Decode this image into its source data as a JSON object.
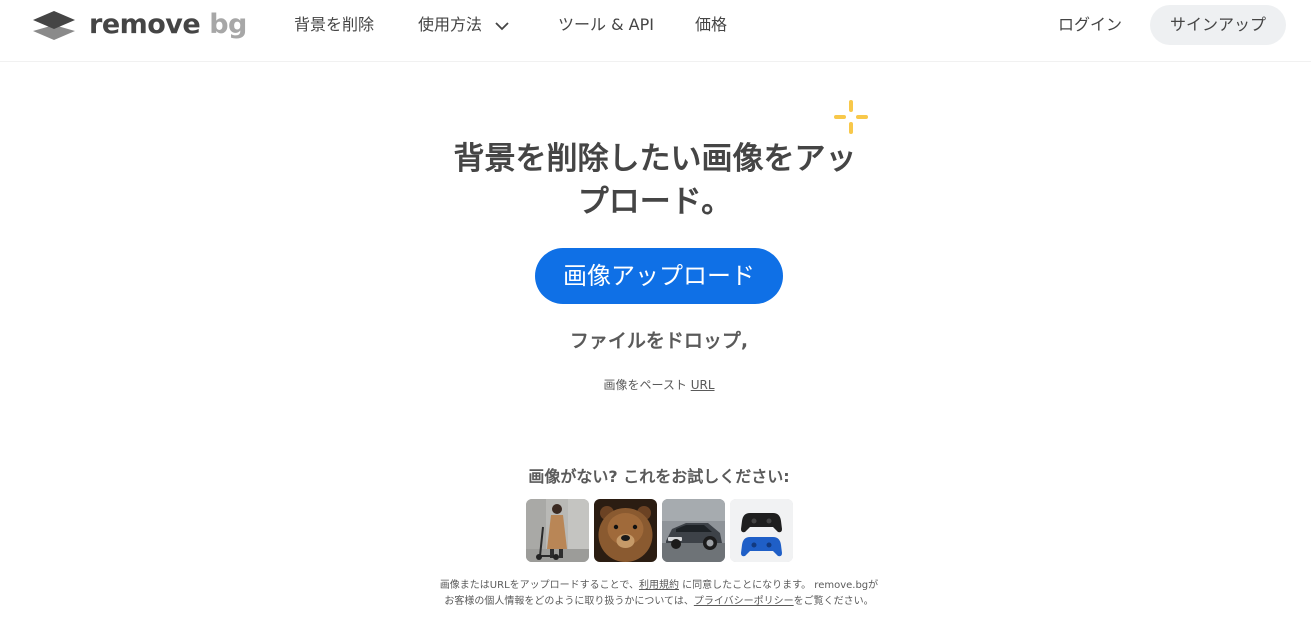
{
  "header": {
    "logo": {
      "word1": "remove",
      "word2": "bg"
    },
    "nav": [
      {
        "label": "背景を削除"
      },
      {
        "label": "使用方法"
      },
      {
        "label": "ツール & API"
      },
      {
        "label": "価格"
      }
    ],
    "login_label": "ログイン",
    "signup_label": "サインアップ"
  },
  "hero": {
    "title_line1": "背景を削除したい画像をアッ",
    "title_line2": "プロード。",
    "upload_button": "画像アップロード",
    "drop_text": "ファイルをドロップ,",
    "paste_text": "画像をペースト",
    "url_link": "URL"
  },
  "samples": {
    "prompt": "画像がない? これをお試しください:",
    "items": [
      "woman-with-scooter",
      "bear",
      "car",
      "game-controllers"
    ]
  },
  "legal": {
    "line1_before": "画像またはURLをアップロードすることで、",
    "terms_link": "利用規約",
    "line1_after": " に同意したことになります。 remove.bgが",
    "line2_before": "お客様の個人情報をどのように取り扱うかについては、",
    "privacy_link": "プライバシーポリシー",
    "line2_after": "をご覧ください。"
  },
  "colors": {
    "primary": "#0f70e6",
    "text": "#454545",
    "logo_grey": "#a7a7a7",
    "sparkle": "#f8c84a",
    "signup_bg": "#eef0f2"
  }
}
